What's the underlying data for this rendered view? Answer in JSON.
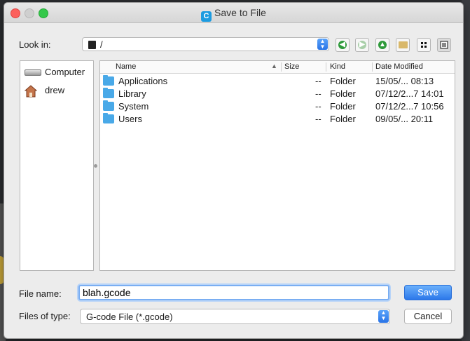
{
  "window": {
    "title": "Save to File"
  },
  "toolbar": {
    "look_in_label": "Look in:",
    "look_in_value": "/",
    "buttons": [
      "back",
      "forward",
      "parent-directory",
      "new-folder",
      "list-view",
      "detail-view"
    ]
  },
  "sidebar": {
    "items": [
      {
        "label": "Computer",
        "icon": "drive-icon"
      },
      {
        "label": "drew",
        "icon": "home-icon"
      }
    ]
  },
  "file_list": {
    "columns": [
      "Name",
      "Size",
      "Kind",
      "Date Modified"
    ],
    "rows": [
      {
        "name": "Applications",
        "size": "--",
        "kind": "Folder",
        "date": "15/05/... 08:13"
      },
      {
        "name": "Library",
        "size": "--",
        "kind": "Folder",
        "date": "07/12/2...7 14:01"
      },
      {
        "name": "System",
        "size": "--",
        "kind": "Folder",
        "date": "07/12/2...7 10:56"
      },
      {
        "name": "Users",
        "size": "--",
        "kind": "Folder",
        "date": "09/05/... 20:11"
      }
    ]
  },
  "form": {
    "file_name_label": "File name:",
    "file_name_value": "blah.gcode",
    "file_type_label": "Files of type:",
    "file_type_value": "G-code File (*.gcode)"
  },
  "actions": {
    "save_label": "Save",
    "cancel_label": "Cancel"
  },
  "colors": {
    "accent": "#2c78ea",
    "folder": "#49a9e8"
  }
}
